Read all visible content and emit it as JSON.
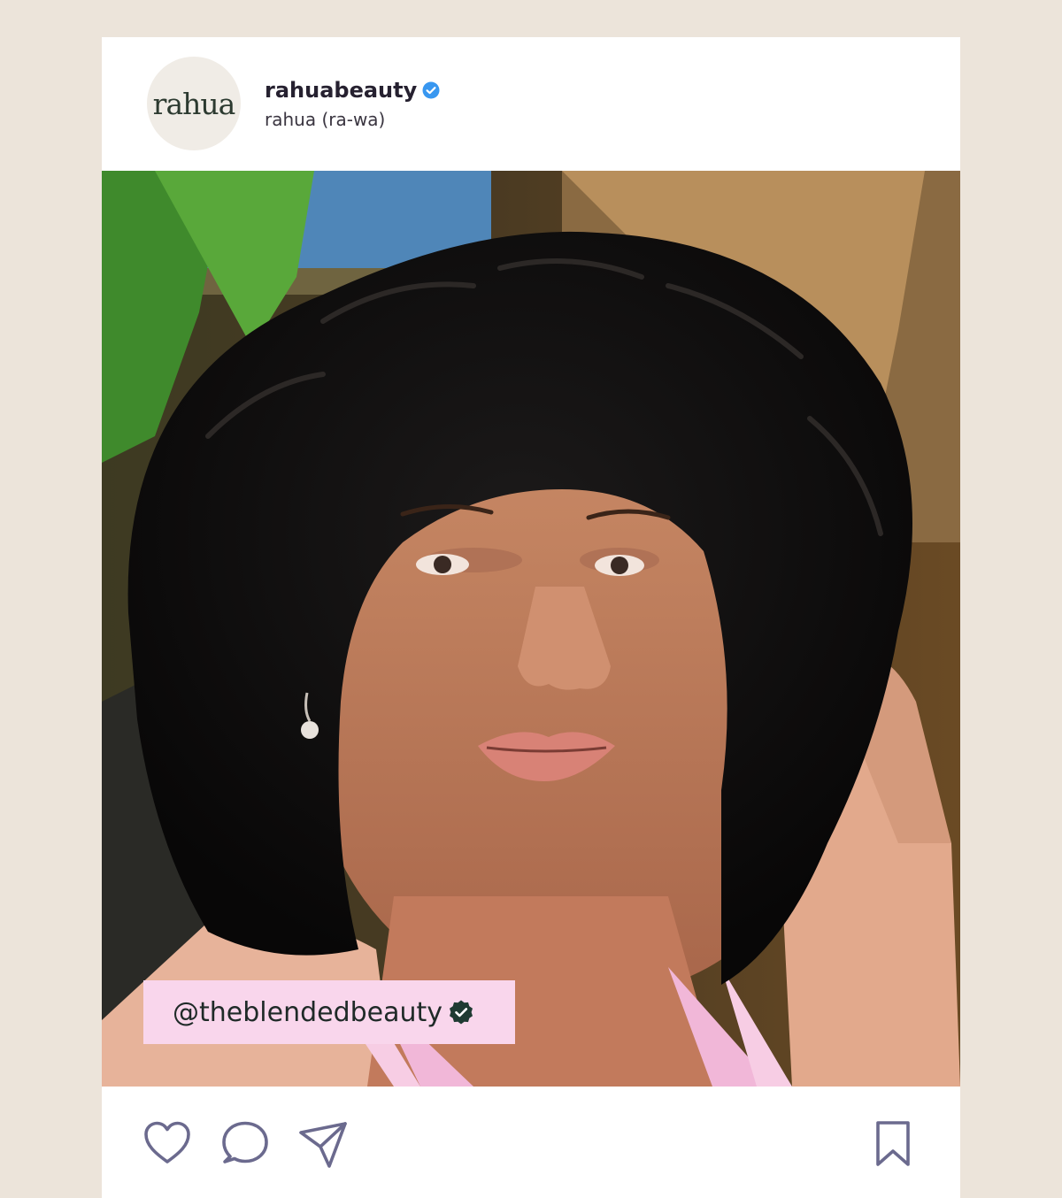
{
  "post": {
    "username": "rahuabeauty",
    "subtitle": "rahua (ra-wa)",
    "avatar_text": "rahua",
    "verified_icon": "verified-badge-icon",
    "tag": "@theblendedbeauty",
    "tag_badge_icon": "verified-badge-icon"
  },
  "actions": {
    "like_icon": "heart-icon",
    "comment_icon": "comment-icon",
    "share_icon": "send-icon",
    "save_icon": "bookmark-icon"
  },
  "colors": {
    "page_background": "#ece4da",
    "card_background": "#ffffff",
    "verified_blue": "#3897f0",
    "tag_background": "#f9d6ec",
    "icon_stroke": "#6b6a8e"
  }
}
